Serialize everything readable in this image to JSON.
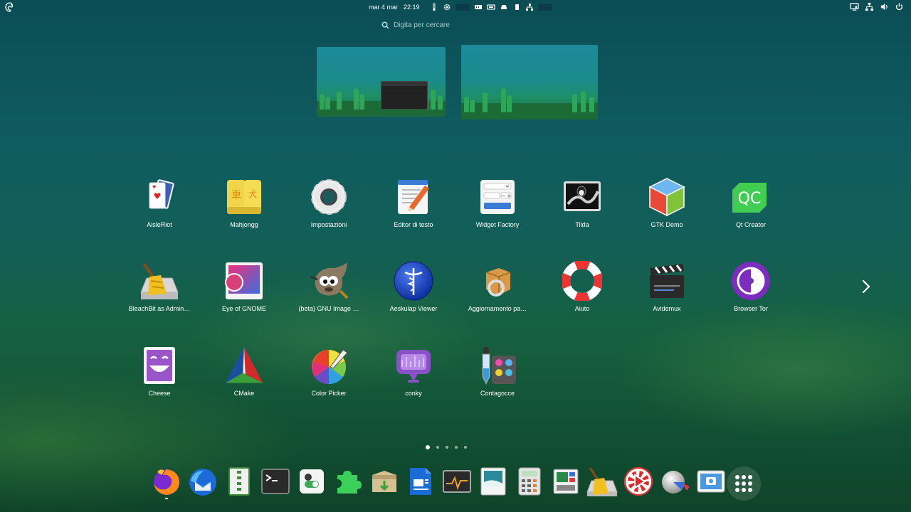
{
  "top_bar": {
    "date": "mar 4 mar",
    "time": "22:19"
  },
  "search": {
    "placeholder": "Digita per cercare"
  },
  "app_grid": {
    "apps": [
      {
        "label": "AisleRiot",
        "icon": "cards-icon"
      },
      {
        "label": "Mahjongg",
        "icon": "mahjongg-icon"
      },
      {
        "label": "Impostazioni",
        "icon": "settings-gear-icon"
      },
      {
        "label": "Editor di testo",
        "icon": "text-editor-icon"
      },
      {
        "label": "Widget Factory",
        "icon": "widget-factory-icon"
      },
      {
        "label": "Tilda",
        "icon": "tilda-icon"
      },
      {
        "label": "GTK Demo",
        "icon": "gtk-demo-icon"
      },
      {
        "label": "Qt Creator",
        "icon": "qt-creator-icon"
      },
      {
        "label": "BleachBit as Admin…",
        "icon": "bleachbit-icon"
      },
      {
        "label": "Eye of GNOME",
        "icon": "eye-of-gnome-icon"
      },
      {
        "label": "(beta) GNU Image …",
        "icon": "gimp-icon"
      },
      {
        "label": "Aeskulap Viewer",
        "icon": "aeskulap-icon"
      },
      {
        "label": "Aggiornamento pa…",
        "icon": "package-update-icon"
      },
      {
        "label": "Aiuto",
        "icon": "help-lifebuoy-icon"
      },
      {
        "label": "Avidemux",
        "icon": "avidemux-icon"
      },
      {
        "label": "Browser Tor",
        "icon": "tor-browser-icon"
      },
      {
        "label": "Cheese",
        "icon": "cheese-icon"
      },
      {
        "label": "CMake",
        "icon": "cmake-icon"
      },
      {
        "label": "Color Picker",
        "icon": "color-picker-icon"
      },
      {
        "label": "conky",
        "icon": "conky-icon"
      },
      {
        "label": "Contagocce",
        "icon": "eyedropper-icon"
      }
    ],
    "page_count": 5,
    "current_page": 1
  },
  "dock": {
    "items": [
      {
        "name": "firefox-icon"
      },
      {
        "name": "thunderbird-icon"
      },
      {
        "name": "file-roller-icon"
      },
      {
        "name": "terminal-icon"
      },
      {
        "name": "gnome-tweaks-icon"
      },
      {
        "name": "extensions-icon"
      },
      {
        "name": "software-install-icon"
      },
      {
        "name": "libreoffice-writer-icon"
      },
      {
        "name": "system-monitor-icon"
      },
      {
        "name": "image-viewer-icon"
      },
      {
        "name": "calculator-icon"
      },
      {
        "name": "hardware-info-icon"
      },
      {
        "name": "bleachbit-icon"
      },
      {
        "name": "video-player-icon"
      },
      {
        "name": "disk-usage-icon"
      },
      {
        "name": "screenshot-icon"
      },
      {
        "name": "show-apps-icon"
      }
    ]
  }
}
